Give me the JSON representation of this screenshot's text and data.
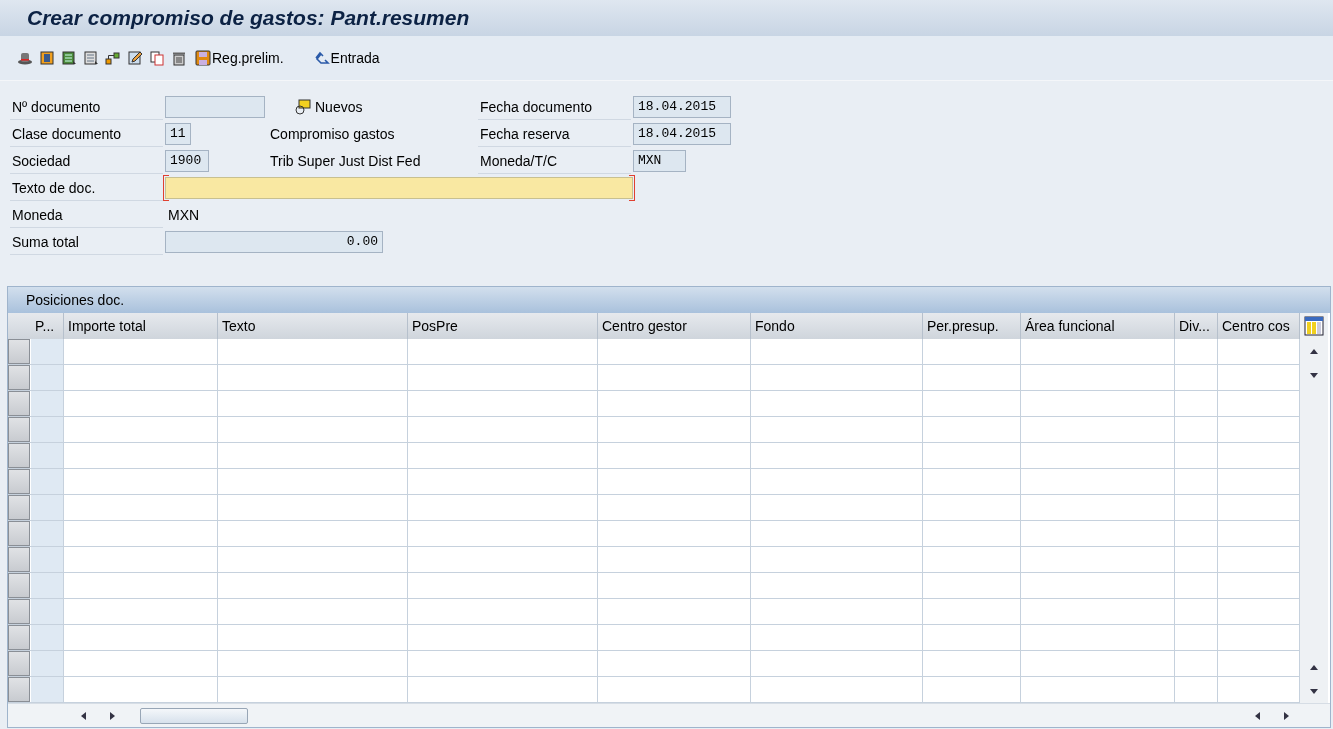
{
  "window": {
    "title": "Crear compromiso de gastos: Pant.resumen"
  },
  "toolbar": {
    "icons": [
      {
        "kind": "hat"
      },
      {
        "kind": "doc"
      },
      {
        "kind": "listgreen"
      },
      {
        "kind": "listgrey"
      },
      {
        "kind": "hierarchy"
      },
      {
        "kind": "pencil"
      },
      {
        "kind": "copy"
      },
      {
        "kind": "trash"
      }
    ],
    "buttons": [
      {
        "label": "Reg.prelim.",
        "kind": "save"
      },
      {
        "label": "Entrada",
        "kind": "arrows"
      }
    ]
  },
  "form": {
    "left": [
      {
        "label": "Nº documento",
        "kind": "input"
      },
      {
        "label": "Clase documento",
        "kind": "input",
        "value": "11"
      },
      {
        "label": "Sociedad",
        "kind": "input",
        "value": "1900"
      },
      {
        "label": "Texto de doc.",
        "kind": "required"
      },
      {
        "label": "Moneda",
        "kind": "text",
        "value": "MXN"
      },
      {
        "label": "Suma total",
        "kind": "amount",
        "value": "0.00"
      }
    ],
    "middle": [
      {
        "kind": "button",
        "label": "Nuevos"
      },
      {
        "kind": "text",
        "label": "Compromiso gastos"
      },
      {
        "kind": "text",
        "label": "Trib Super Just Dist Fed"
      }
    ],
    "right": [
      {
        "label": "Fecha documento",
        "value": "18.04.2015"
      },
      {
        "label": "Fecha reserva",
        "value": "18.04.2015"
      },
      {
        "label": "Moneda/T/C",
        "value": "MXN"
      }
    ]
  },
  "table": {
    "title": "Posiciones doc.",
    "columns": [
      "P...",
      "Importe total",
      "Texto",
      "PosPre",
      "Centro gestor",
      "Fondo",
      "Per.presup.",
      "Área funcional",
      "Div...",
      "Centro cos"
    ]
  }
}
